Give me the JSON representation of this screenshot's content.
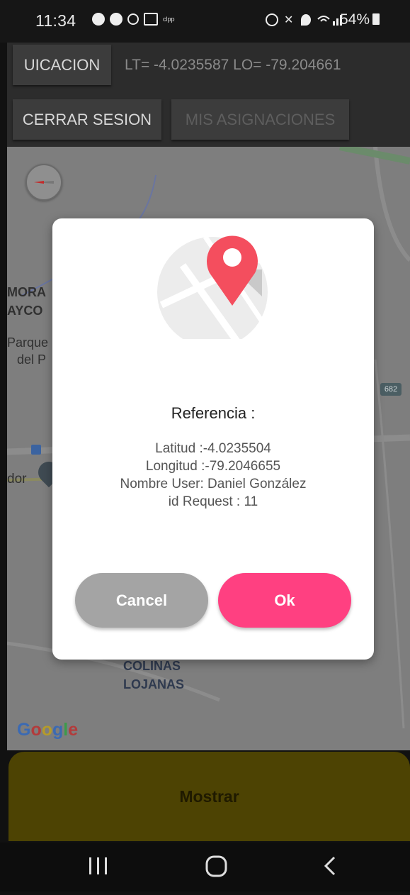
{
  "status_bar": {
    "time": "11:34",
    "battery": "54%",
    "notification_text": "clpp"
  },
  "header": {
    "location_button_label": "UICACION",
    "coords_text": "LT= -4.0235587 LO= -79.204661",
    "logout_button_label": "CERRAR SESION",
    "assignments_button_label": "MIS ASIGNACIONES"
  },
  "map": {
    "labels": {
      "mora": "MORA",
      "ayco": "AYCO",
      "parque": "Parque",
      "del_p": "del P",
      "dor": "dor",
      "colinas": "COLINAS",
      "lojanas": "LOJANAS",
      "route_badge": "682"
    },
    "google_logo": "Google"
  },
  "dialog": {
    "title": "Referencia :",
    "latitude": "Latitud :-4.0235504",
    "longitude": "Longitud :-79.2046655",
    "user_name": "Nombre User: Daniel González",
    "request_id": "id Request : 11",
    "cancel_label": "Cancel",
    "ok_label": "Ok"
  },
  "bottom": {
    "show_button_label": "Mostrar"
  },
  "colors": {
    "pin": "#f44e5e",
    "ok_button": "#ff4081",
    "cancel_button": "#a4a4a4",
    "show_button": "#4d4303"
  }
}
